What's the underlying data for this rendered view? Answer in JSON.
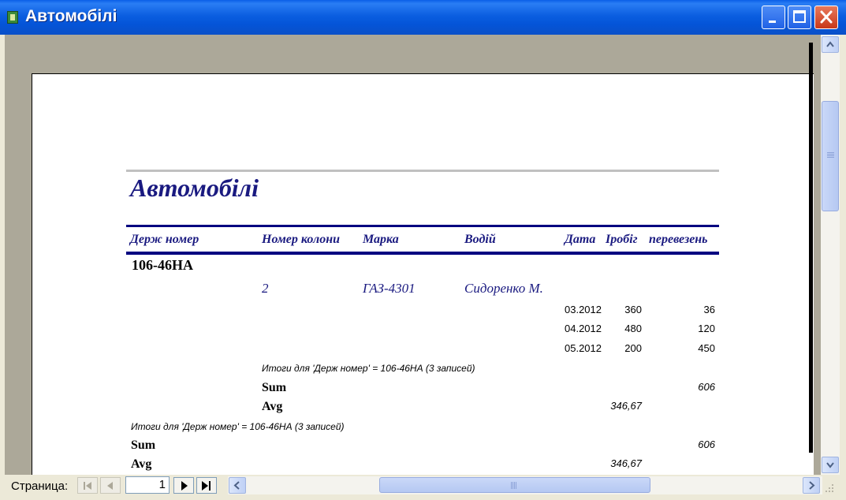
{
  "window": {
    "title": "Автомобілі"
  },
  "report": {
    "title": "Автомобілі",
    "columns": [
      "Держ номер",
      "Номер колони",
      "Марка",
      "Водій",
      "Дата",
      "Пробіг",
      "Кількість перевезень"
    ],
    "column_visible": [
      "Держ номер",
      "Номер колони",
      "Марка",
      "Водій",
      "Дата",
      "Іробіг",
      "перевезень"
    ],
    "group_value": "106-46НА",
    "detail": {
      "column_no": "2",
      "brand": "ГАЗ-4301",
      "driver": "Сидоренко М."
    },
    "rows": [
      {
        "date": "03.2012",
        "mileage": "360",
        "trips": "36"
      },
      {
        "date": "04.2012",
        "mileage": "480",
        "trips": "120"
      },
      {
        "date": "05.2012",
        "mileage": "200",
        "trips": "450"
      }
    ],
    "inner_summary": {
      "text": "Итоги для 'Держ номер' =  106-46НА (3 записей)",
      "sum_label": "Sum",
      "sum_value": "606",
      "avg_label": "Avg",
      "avg_value": "346,67"
    },
    "outer_summary": {
      "text": "Итоги для 'Держ номер' =  106-46НА (3 записей)",
      "sum_label": "Sum",
      "sum_value": "606",
      "avg_label": "Avg",
      "avg_value": "346,67"
    }
  },
  "navigation": {
    "page_label": "Страница:",
    "current_page": "1"
  }
}
